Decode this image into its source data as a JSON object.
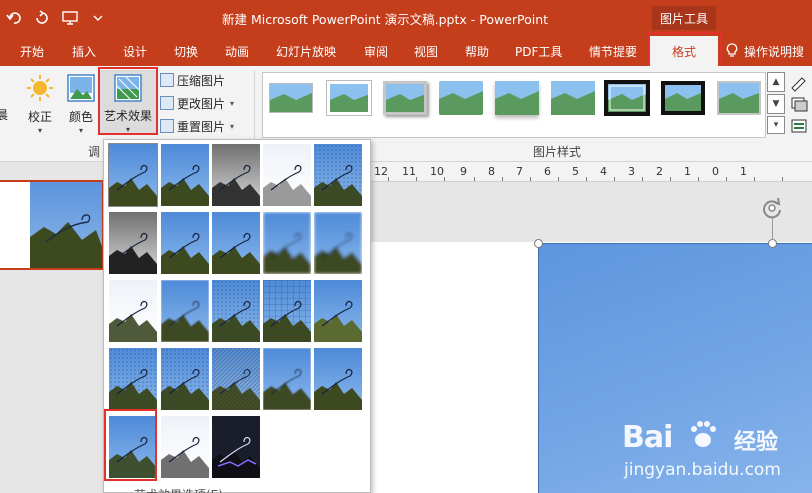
{
  "window": {
    "title": "新建 Microsoft PowerPoint 演示文稿.pptx  -  PowerPoint",
    "contextual_label": "图片工具"
  },
  "tabs": [
    "开始",
    "插入",
    "设计",
    "切换",
    "动画",
    "幻灯片放映",
    "审阅",
    "视图",
    "帮助",
    "PDF工具",
    "情节提要",
    "格式"
  ],
  "tell_me": "操作说明搜",
  "ribbon": {
    "left_fragment": "晨",
    "buttons": {
      "corrections": "校正",
      "color": "颜色",
      "artistic": "艺术效果"
    },
    "small_buttons": [
      "压缩图片",
      "更改图片",
      "重置图片"
    ],
    "group_adjust_fragment": "调",
    "group_styles": "图片样式"
  },
  "ruler": {
    "ticks": [
      "12",
      "11",
      "10",
      "9",
      "8",
      "7",
      "6",
      "5",
      "4",
      "3",
      "2",
      "1",
      "0",
      "1"
    ]
  },
  "gallery_footer": "艺术效果选项(E)...",
  "watermark": {
    "logo": "Bai",
    "text": "经验",
    "url": "jingyan.baidu.com"
  },
  "colors": {
    "accent": "#c43e1c",
    "highlight": "#e0312d"
  }
}
